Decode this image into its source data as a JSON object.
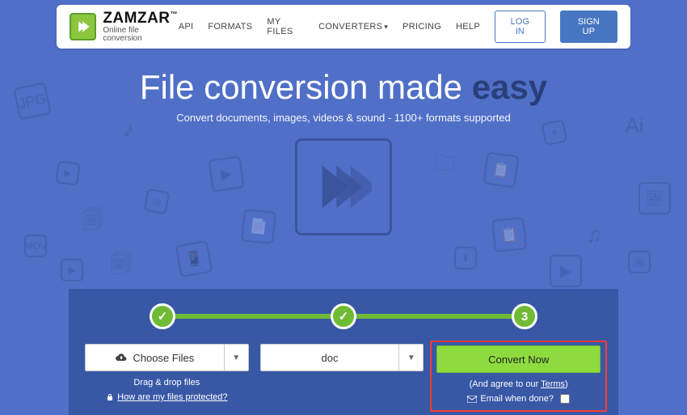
{
  "brand": {
    "name": "ZAMZAR",
    "tm": "™",
    "tagline": "Online file conversion"
  },
  "nav": {
    "api": "API",
    "formats": "FORMATS",
    "myfiles": "MY FILES",
    "converters": "CONVERTERS",
    "pricing": "PRICING",
    "help": "HELP",
    "login": "LOG IN",
    "signup": "SIGN UP"
  },
  "hero": {
    "title_prefix": "File conversion made ",
    "title_emph": "easy",
    "subtitle": "Convert documents, images, videos & sound - 1100+ formats supported"
  },
  "steps": {
    "s1": "✓",
    "s2": "✓",
    "s3": "3"
  },
  "converter": {
    "choose": "Choose Files",
    "drag": "Drag & drop files",
    "protected": "How are my files protected?",
    "format": "doc",
    "convert": "Convert Now",
    "agree_prefix": "(And agree to our ",
    "agree_link": "Terms",
    "agree_suffix": ")",
    "email": "Email when done?"
  }
}
